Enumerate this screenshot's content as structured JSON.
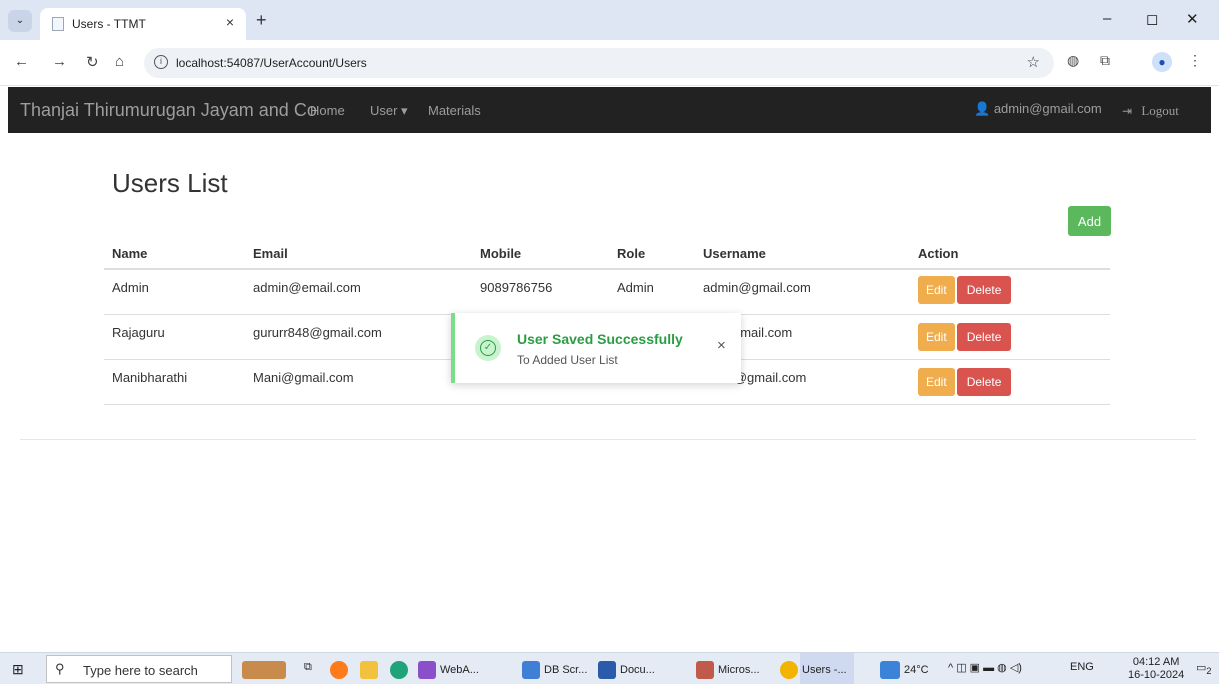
{
  "browser": {
    "tab_title": "Users - TTMT",
    "tab_close": "×",
    "new_tab": "+",
    "url": "localhost:54087/UserAccount/Users",
    "window_controls": {
      "minimize": "–",
      "maximize": "◻",
      "close": "✕"
    }
  },
  "navbar": {
    "brand": "Thanjai Thirumurugan Jayam and Co",
    "links": [
      "Home",
      "User ▾",
      "Materials"
    ],
    "user_email": "admin@gmail.com",
    "logout": "Logout"
  },
  "page": {
    "title": "Users List",
    "add_button": "Add"
  },
  "table": {
    "headers": [
      "Name",
      "Email",
      "Mobile",
      "Role",
      "Username",
      "Action"
    ],
    "rows": [
      {
        "name": "Admin",
        "email": "admin@email.com",
        "mobile": "9089786756",
        "role": "Admin",
        "username": "admin@gmail.com"
      },
      {
        "name": "Rajaguru",
        "email": "gururr848@gmail.com",
        "mobile": "",
        "role": "",
        "username": "gmail.com"
      },
      {
        "name": "Manibharathi",
        "email": "Mani@gmail.com",
        "mobile": "",
        "role": "",
        "username": ".3@gmail.com"
      }
    ],
    "edit_label": "Edit",
    "delete_label": "Delete"
  },
  "toast": {
    "title": "User Saved Successfully",
    "message": "To Added User List",
    "close": "×"
  },
  "taskbar": {
    "search_placeholder": "Type here to search",
    "apps": [
      "WebA...",
      "DB Scr...",
      "Docu...",
      "Micros...",
      "Users -..."
    ],
    "weather": "24°C",
    "language": "ENG",
    "time": "04:12 AM",
    "date": "16-10-2024",
    "notifications": "2"
  },
  "icons": {
    "user_icon": "user-icon",
    "logout_icon": "logout-icon",
    "success_icon": "check-circle-icon"
  },
  "colors": {
    "navbar_bg": "#222222",
    "add_button": "#5cb85c",
    "edit_button": "#f0ad4e",
    "delete_button": "#d9534f",
    "toast_success": "#2a9d43"
  }
}
